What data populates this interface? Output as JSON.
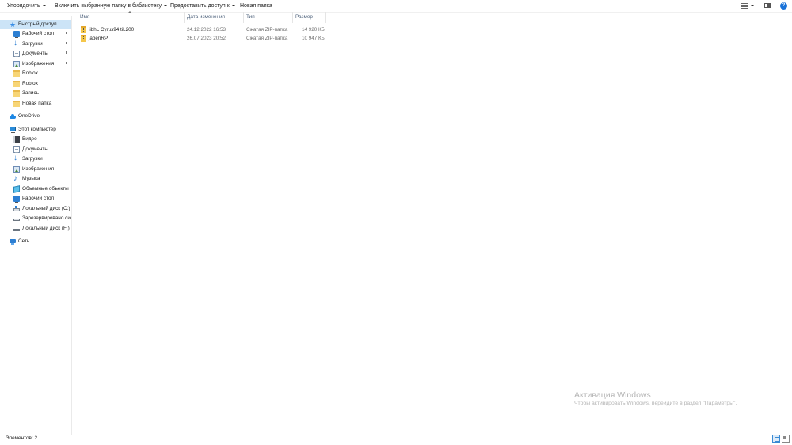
{
  "toolbar": {
    "organize": "Упорядочить",
    "include_library": "Включить выбранную папку в библиотеку",
    "share": "Предоставить доступ к",
    "new_folder": "Новая папка"
  },
  "nav": {
    "quick_access": "Быстрый доступ",
    "quick_items": [
      {
        "label": "Рабочий стол",
        "icon": "desktop-icon",
        "pinned": true
      },
      {
        "label": "Загрузки",
        "icon": "downloads-icon",
        "pinned": true
      },
      {
        "label": "Документы",
        "icon": "documents-icon",
        "pinned": true
      },
      {
        "label": "Изображения",
        "icon": "pictures-icon",
        "pinned": true
      },
      {
        "label": "Roblox",
        "icon": "folder-icon",
        "pinned": false
      },
      {
        "label": "Roblox",
        "icon": "folder-icon",
        "pinned": false
      },
      {
        "label": "Запись",
        "icon": "folder-icon",
        "pinned": false
      },
      {
        "label": "Новая папка",
        "icon": "folder-icon",
        "pinned": false
      }
    ],
    "onedrive": "OneDrive",
    "this_pc": "Этот компьютер",
    "pc_items": [
      {
        "label": "Видео",
        "icon": "video-icon"
      },
      {
        "label": "Документы",
        "icon": "documents-icon"
      },
      {
        "label": "Загрузки",
        "icon": "downloads-icon"
      },
      {
        "label": "Изображения",
        "icon": "pictures-icon"
      },
      {
        "label": "Музыка",
        "icon": "music-icon"
      },
      {
        "label": "Объемные объекты",
        "icon": "3d-objects-icon"
      },
      {
        "label": "Рабочий стол",
        "icon": "desktop-icon"
      },
      {
        "label": "Локальный диск (C:)",
        "icon": "drive-c-icon"
      },
      {
        "label": "Зарезервировано сис",
        "icon": "drive-icon"
      },
      {
        "label": "Локальный диск (F:)",
        "icon": "drive-icon"
      }
    ],
    "network": "Сеть"
  },
  "columns": {
    "name": "Имя",
    "date": "Дата изменения",
    "type": "Тип",
    "size": "Размер"
  },
  "files": [
    {
      "name": "libhL      Cyrus94 tiL200",
      "date": "24.12.2022 16:53",
      "type": "Сжатая ZIP-папка",
      "size": "14 920 КБ"
    },
    {
      "name": "jabenRP",
      "date": "26.07.2023 20:52",
      "type": "Сжатая ZIP-папка",
      "size": "10 947 КБ"
    }
  ],
  "watermark": {
    "title": "Активация Windows",
    "subtitle": "Чтобы активировать Windows, перейдите в раздел \"Параметры\"."
  },
  "status": {
    "count": "Элементов: 2"
  },
  "colors": {
    "selection": "#cce4f7",
    "accent": "#1a73d9",
    "header_text": "#4c607a"
  }
}
